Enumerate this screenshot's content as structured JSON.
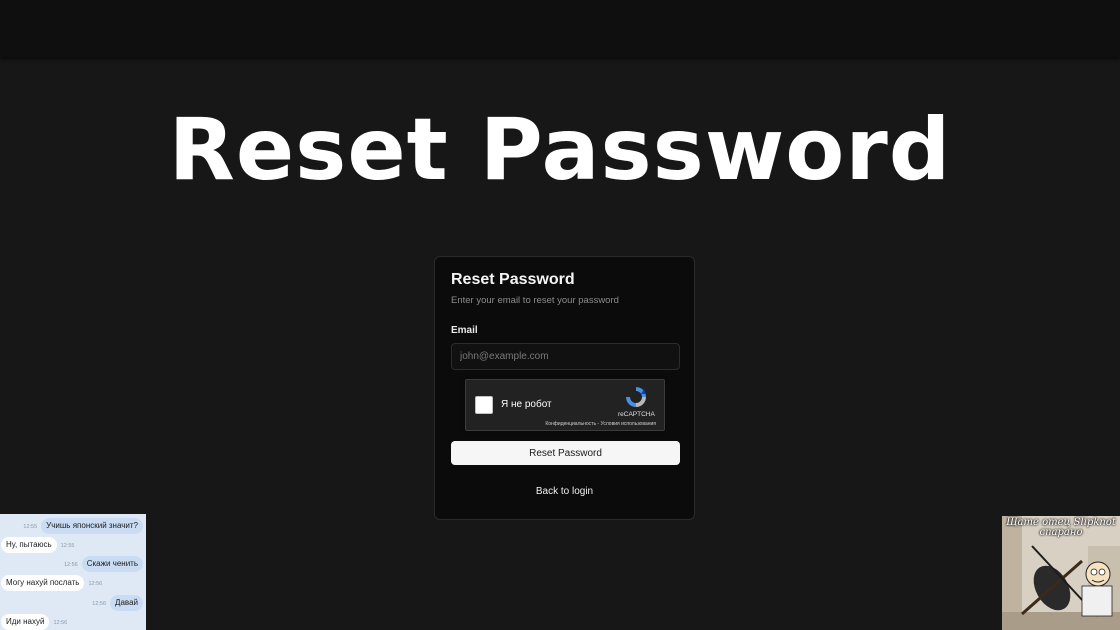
{
  "headline": "Reset Password",
  "card": {
    "title": "Reset Password",
    "subtitle": "Enter your email to reset your password",
    "email_label": "Email",
    "email_placeholder": "john@example.com",
    "email_value": "",
    "recaptcha": {
      "checkbox_label": "Я не робот",
      "brand": "reCAPTCHA",
      "links": "Конфиденциальность - Условия использования"
    },
    "submit_label": "Reset Password",
    "back_label": "Back to login"
  },
  "chat": {
    "messages": [
      {
        "dir": "out",
        "time": "12:55",
        "text": "Учишь японский значит?"
      },
      {
        "dir": "in",
        "time": "12:55",
        "text": "Ну, пытаюсь"
      },
      {
        "dir": "out",
        "time": "12:56",
        "text": "Скажи ченить"
      },
      {
        "dir": "in",
        "time": "12:56",
        "text": "Могу нахуй послать"
      },
      {
        "dir": "out",
        "time": "12:56",
        "text": "Давай"
      },
      {
        "dir": "in",
        "time": "12:56",
        "text": "Иди нахуй"
      }
    ]
  },
  "meme": {
    "caption_line1": "Щате отец Slipknot",
    "caption_line2": "спарано"
  },
  "colors": {
    "background": "#171717",
    "card": "#0b0b0b",
    "button": "#f6f6f6"
  }
}
